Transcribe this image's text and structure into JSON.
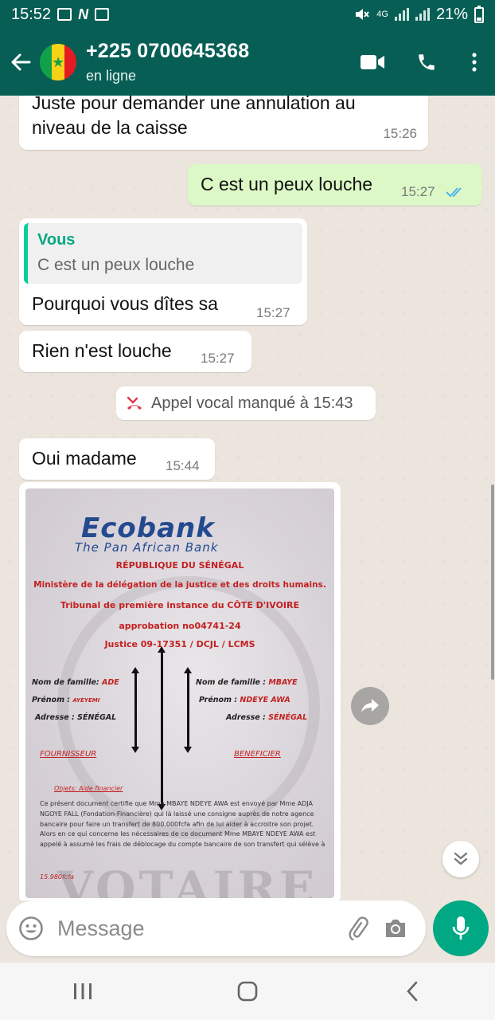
{
  "status_bar": {
    "time": "15:52",
    "n_label": "N",
    "network": "4G",
    "battery": "21%"
  },
  "header": {
    "contact_name": "+225 0700645368",
    "contact_status": "en ligne",
    "icons": [
      "back-arrow-icon",
      "video-call-icon",
      "voice-call-icon",
      "more-options-icon"
    ]
  },
  "messages": [
    {
      "direction": "in",
      "text": "Juste pour demander une annulation au niveau de la caisse",
      "time": "15:26"
    },
    {
      "direction": "out",
      "text": "C est un peux louche",
      "time": "15:27",
      "status": "read"
    },
    {
      "direction": "in",
      "quote_author": "Vous",
      "quote_text": "C est un peux louche",
      "text": "Pourquoi vous dîtes sa",
      "time": "15:27"
    },
    {
      "direction": "in",
      "text": "Rien n'est louche",
      "time": "15:27"
    },
    {
      "direction": "in",
      "text": "Oui madame",
      "time": "15:44"
    }
  ],
  "system_message": "Appel vocal manqué à 15:43",
  "document_image": {
    "logo": "Ecobank",
    "logo_tagline": "The Pan African Bank",
    "lines": [
      "RÉPUBLIQUE DU SÉNÉGAL",
      "Ministère de la délégation de la justice et des droits humains.",
      "Tribunal de première instance du CÔTE D'IVOIRE",
      "approbation no04741-24",
      "Justice 09-17351 / DCJL / LCMS"
    ],
    "left_party": {
      "nom_label": "Nom de famille:",
      "nom": "ADE",
      "prenom_label": "Prénom :",
      "prenom": "AYEYEMI",
      "adresse_label": "Adresse :",
      "adresse": "SÉNÉGAL",
      "role": "FOURNISSEUR"
    },
    "right_party": {
      "nom_label": "Nom de famille :",
      "nom": "MBAYE",
      "prenom_label": "Prénom :",
      "prenom": "NDEYE AWA",
      "adresse_label": "Adresse :",
      "adresse": "SÉNÉGAL",
      "role": "BENEFICIER"
    },
    "objet": "Objets: Aide financier",
    "body": "Ce présent document certifie que Mme MBAYE NDEYE AWA est envoyé par Mme ADJA NGOYE FALL (Fondation-Financière) qui là laissé une consigne auprès de notre agence bancaire pour faire un transfert de 800.000fcfa afin de lui aider à accroitre son projet. Alors en ce qui concerne les nécessaires de ce document Mme MBAYE NDEYE AWA est appelé à assumé les frais de déblocage du compte bancaire de son transfert qui sélève à",
    "amount": "15.980fcfa",
    "watermark": "VOTAIRE"
  },
  "composer": {
    "placeholder": "Message"
  },
  "colors": {
    "header": "#075e54",
    "outgoing_bubble": "#dcf8c6",
    "accent": "#00a884",
    "chat_bg": "#ece5dd"
  }
}
